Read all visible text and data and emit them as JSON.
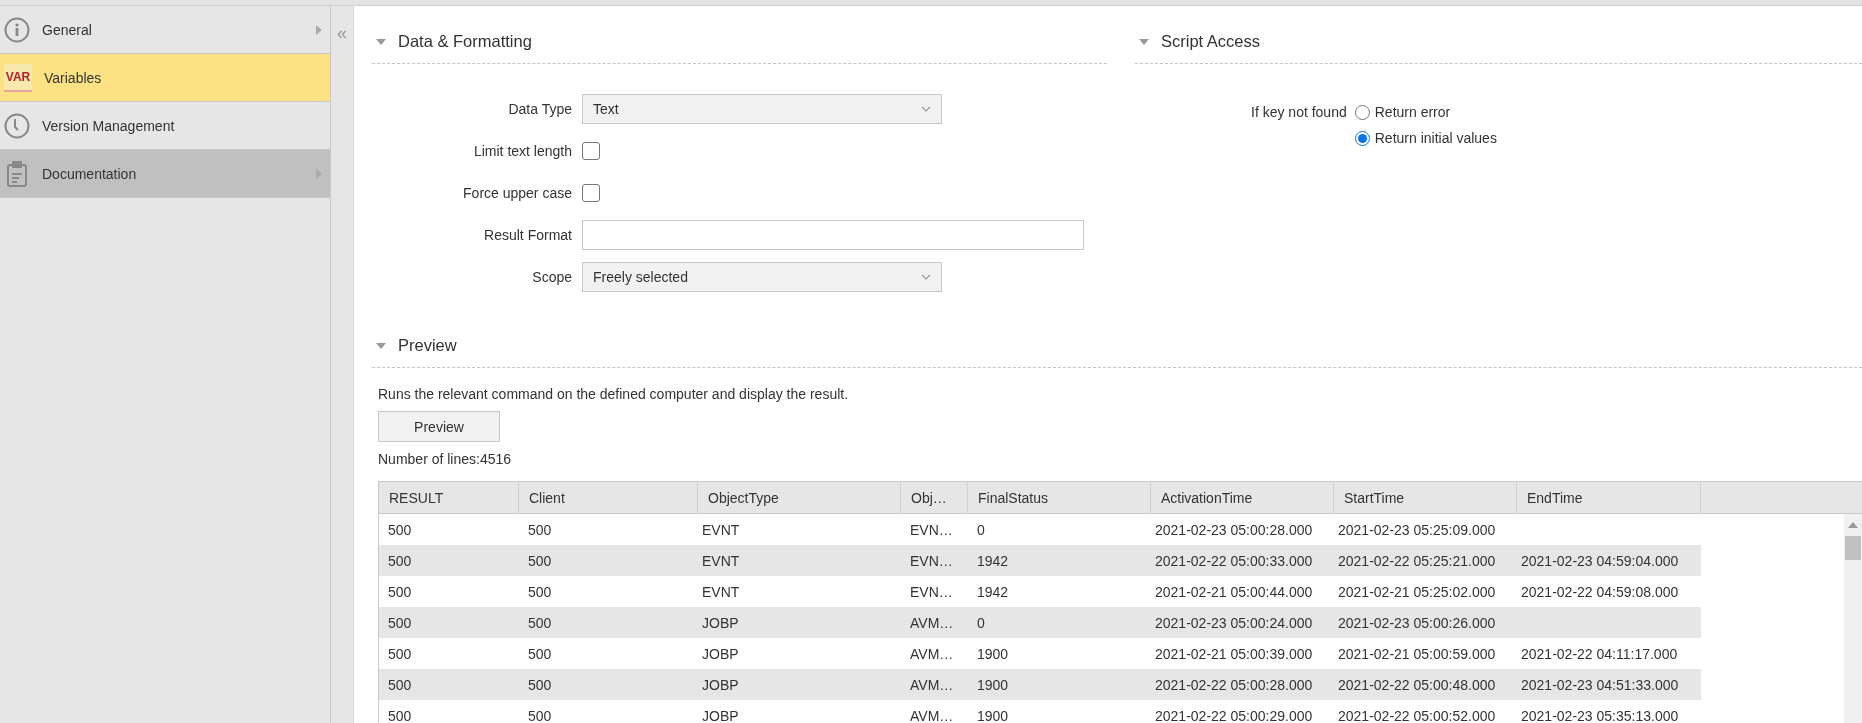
{
  "sidebar": {
    "items": [
      {
        "label": "General",
        "kind": "info",
        "selected": false,
        "highlighted": false,
        "expandable": true
      },
      {
        "label": "Variables",
        "kind": "var",
        "icon_text": "VAR",
        "selected": true,
        "highlighted": false,
        "expandable": false
      },
      {
        "label": "Version Management",
        "kind": "clock",
        "selected": false,
        "highlighted": false,
        "expandable": false
      },
      {
        "label": "Documentation",
        "kind": "clipboard",
        "selected": false,
        "highlighted": true,
        "expandable": true
      }
    ],
    "collapse": "«"
  },
  "data_formatting": {
    "title": "Data & Formatting",
    "expanded": true,
    "fields": [
      {
        "kind": "select",
        "label": "Data Type",
        "value": "Text"
      },
      {
        "kind": "checkbox",
        "label": "Limit text length",
        "checked": false
      },
      {
        "kind": "checkbox",
        "label": "Force upper case",
        "checked": false
      },
      {
        "kind": "text",
        "label": "Result Format"
      },
      {
        "kind": "select",
        "label": "Scope",
        "value": "Freely selected"
      }
    ]
  },
  "script_access": {
    "title": "Script Access",
    "expanded": true,
    "label": "If key not found",
    "options": [
      {
        "label": "Return error",
        "selected": false
      },
      {
        "label": "Return initial values",
        "selected": true
      }
    ]
  },
  "preview": {
    "title": "Preview",
    "expanded": true,
    "description": "Runs the relevant command on the defined computer and display the result.",
    "button": "Preview",
    "line_count": "Number of lines:4516",
    "table": {
      "columns": [
        "RESULT",
        "Client",
        "ObjectType",
        "Obj…",
        "FinalStatus",
        "ActivationTime",
        "StartTime",
        "EndTime"
      ],
      "rows": [
        [
          "500",
          "500",
          "EVNT",
          "EVN…",
          "0",
          "2021-02-23 05:00:28.000",
          "2021-02-23 05:25:09.000",
          null
        ],
        [
          "500",
          "500",
          "EVNT",
          "EVN…",
          "1942",
          "2021-02-22 05:00:33.000",
          "2021-02-22 05:25:21.000",
          "2021-02-23 04:59:04.000"
        ],
        [
          "500",
          "500",
          "EVNT",
          "EVN…",
          "1942",
          "2021-02-21 05:00:44.000",
          "2021-02-21 05:25:02.000",
          "2021-02-22 04:59:08.000"
        ],
        [
          "500",
          "500",
          "JOBP",
          "AVM…",
          "0",
          "2021-02-23 05:00:24.000",
          "2021-02-23 05:00:26.000",
          null
        ],
        [
          "500",
          "500",
          "JOBP",
          "AVM…",
          "1900",
          "2021-02-21 05:00:39.000",
          "2021-02-21 05:00:59.000",
          "2021-02-22 04:11:17.000"
        ],
        [
          "500",
          "500",
          "JOBP",
          "AVM…",
          "1900",
          "2021-02-22 05:00:28.000",
          "2021-02-22 05:00:48.000",
          "2021-02-23 04:51:33.000"
        ],
        [
          "500",
          "500",
          "JOBP",
          "AVM…",
          "1900",
          "2021-02-22 05:00:29.000",
          "2021-02-22 05:00:52.000",
          "2021-02-23 05:35:13.000"
        ]
      ]
    }
  }
}
